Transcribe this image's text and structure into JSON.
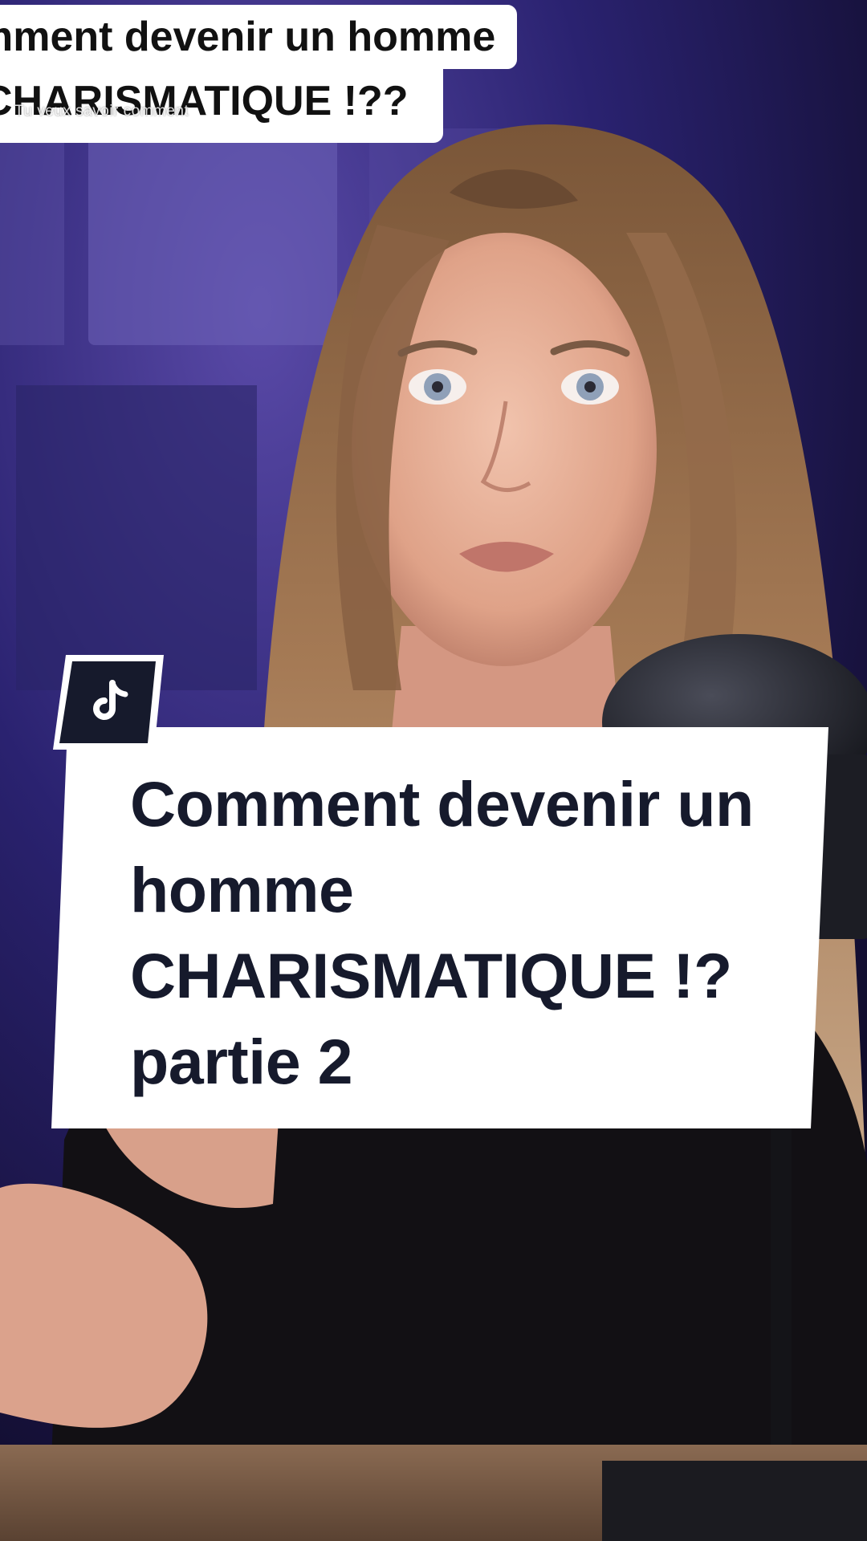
{
  "overlay_caption": {
    "line_1": "mment devenir un homme",
    "line_2": "CHARISMATIQUE !??",
    "ghost_text": "Tu veux savoir comment"
  },
  "title_card": {
    "lines": [
      "Comment devenir un",
      "homme",
      "CHARISMATIQUE !?",
      "partie 2"
    ]
  },
  "badge": {
    "icon": "tiktok-logo-icon"
  },
  "colors": {
    "card_background": "#ffffff",
    "title_text": "#161a2c",
    "badge_background": "#161a2c",
    "scene_violet": "#3a2e8a"
  }
}
